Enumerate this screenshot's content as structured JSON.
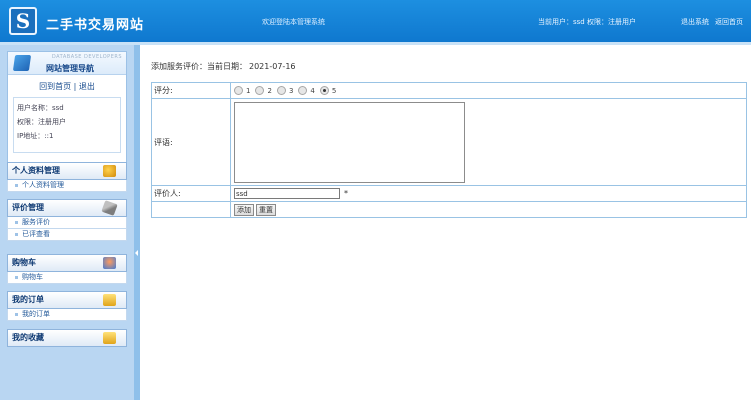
{
  "header": {
    "logo_char": "S",
    "site_title": "二手书交易网站",
    "welcome": "欢迎登陆本管理系统",
    "user_info": "当前用户：ssd 权限：注册用户",
    "logout": "退出系统",
    "home": "返回首页"
  },
  "sidebar": {
    "small_title": "DATABASE DEVELOPERS",
    "nav_title": "网站管理导航",
    "home_link": "回到首页",
    "separator": "|",
    "logout_link": "退出",
    "username_line": "用户名称：ssd",
    "role_line": "权限：注册用户",
    "ip_line": "IP地址：::1",
    "menus": [
      {
        "title": "个人资料管理",
        "icon": "user-icon",
        "items": [
          "个人资料管理"
        ]
      },
      {
        "title": "评价管理",
        "icon": "tools-icon",
        "items": [
          "服务评价",
          "已评查看"
        ]
      },
      {
        "title": "购物车",
        "icon": "people-icon",
        "items": [
          "购物车"
        ]
      },
      {
        "title": "我的订单",
        "icon": "bag-icon",
        "items": [
          "我的订单"
        ]
      },
      {
        "title": "我的收藏",
        "icon": "bag-icon",
        "items": []
      }
    ]
  },
  "main": {
    "crumb_label": "添加服务评价：",
    "date_label": "当前日期：",
    "date": "2021-07-16",
    "form": {
      "rating_label": "评分:",
      "rating_options": [
        "1",
        "2",
        "3",
        "4",
        "5"
      ],
      "rating_selected": "5",
      "comment_label": "评语:",
      "comment_value": "",
      "reviewer_label": "评价人:",
      "reviewer_value": "ssd",
      "required_mark": "*",
      "add_button": "添加",
      "reset_button": "重置"
    }
  }
}
